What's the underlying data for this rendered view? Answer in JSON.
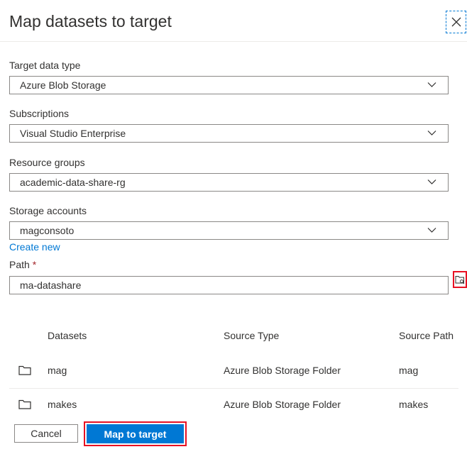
{
  "dialog": {
    "title": "Map datasets to target",
    "close_icon": "close-icon"
  },
  "form": {
    "target_data_type": {
      "label": "Target data type",
      "value": "Azure Blob Storage"
    },
    "subscriptions": {
      "label": "Subscriptions",
      "value": "Visual Studio Enterprise"
    },
    "resource_groups": {
      "label": "Resource groups",
      "value": "academic-data-share-rg"
    },
    "storage_accounts": {
      "label": "Storage accounts",
      "value": "magconsoto"
    },
    "create_new_link": "Create new",
    "path": {
      "label": "Path",
      "required_marker": "*",
      "value": "ma-datashare",
      "browse_icon": "folder-browse-icon"
    }
  },
  "table": {
    "headers": {
      "datasets": "Datasets",
      "source_type": "Source Type",
      "source_path": "Source Path"
    },
    "rows": [
      {
        "icon": "folder-icon",
        "dataset": "mag",
        "source_type": "Azure Blob Storage Folder",
        "source_path": "mag"
      },
      {
        "icon": "folder-icon",
        "dataset": "makes",
        "source_type": "Azure Blob Storage Folder",
        "source_path": "makes"
      }
    ]
  },
  "footer": {
    "cancel_label": "Cancel",
    "primary_label": "Map to target"
  },
  "colors": {
    "accent": "#0078d4",
    "highlight_outline": "#e81123",
    "required": "#a4262c"
  }
}
